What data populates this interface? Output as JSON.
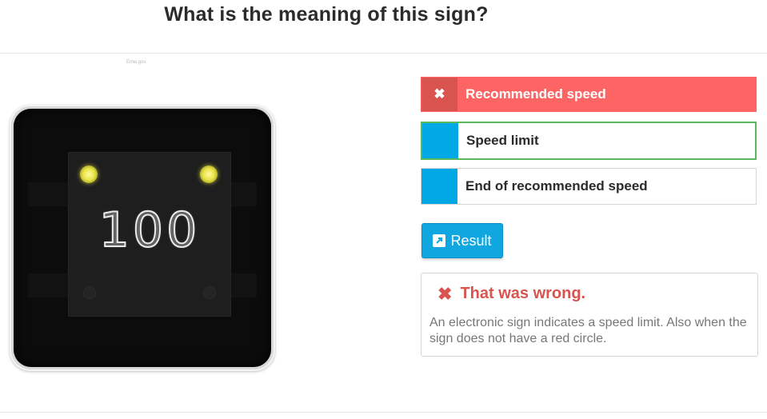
{
  "question": "What is the meaning of this sign?",
  "image_credit": "Emw.gov",
  "sign": {
    "value": "100"
  },
  "answers": [
    {
      "label": "Recommended speed",
      "state": "wrong",
      "marker": "✖"
    },
    {
      "label": "Speed limit",
      "state": "correct",
      "marker": ""
    },
    {
      "label": "End of recommended speed",
      "state": "neutral",
      "marker": ""
    }
  ],
  "result_button": {
    "label": "Result",
    "icon": "external-link-icon"
  },
  "feedback": {
    "icon": "✖",
    "heading": "That was wrong.",
    "text": "An electronic sign indicates a speed limit. Also when the sign does not have a red circle."
  },
  "colors": {
    "wrong_bg": "#fd6565",
    "wrong_tab": "#d9534f",
    "tab_blue": "#00a8e6",
    "correct_border": "#5cb85c",
    "button_blue": "#10a6e0",
    "lamp_yellow": "#e9e44a"
  }
}
